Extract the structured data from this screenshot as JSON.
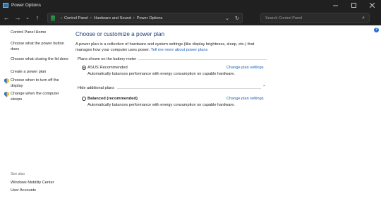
{
  "window": {
    "title": "Power Options"
  },
  "nav": {
    "breadcrumb": [
      "Control Panel",
      "Hardware and Sound",
      "Power Options"
    ],
    "search_placeholder": "Search Control Panel"
  },
  "sidebar": {
    "home": "Control Panel Home",
    "links": [
      "Choose what the power button does",
      "Choose what closing the lid does",
      "Create a power plan",
      "Choose when to turn off the display",
      "Change when the computer sleeps"
    ],
    "see_also_label": "See also",
    "see_also": [
      "Windows Mobility Center",
      "User Accounts"
    ]
  },
  "main": {
    "heading": "Choose or customize a power plan",
    "description": "A power plan is a collection of hardware and system settings (like display brightness, sleep, etc.) that manages how your computer uses power.",
    "description_link": "Tell me more about power plans",
    "battery_group_label": "Plans shown on the battery meter",
    "hidden_group_label": "Hide additional plans",
    "plans": [
      {
        "name": "ASUS Recommended",
        "description": "Automatically balances performance with energy consumption on capable hardware.",
        "link": "Change plan settings",
        "selected": true
      },
      {
        "name": "Balanced (recommended)",
        "description": "Automatically balances performance with energy consumption on capable hardware.",
        "link": "Change plan settings",
        "selected": false
      }
    ]
  }
}
